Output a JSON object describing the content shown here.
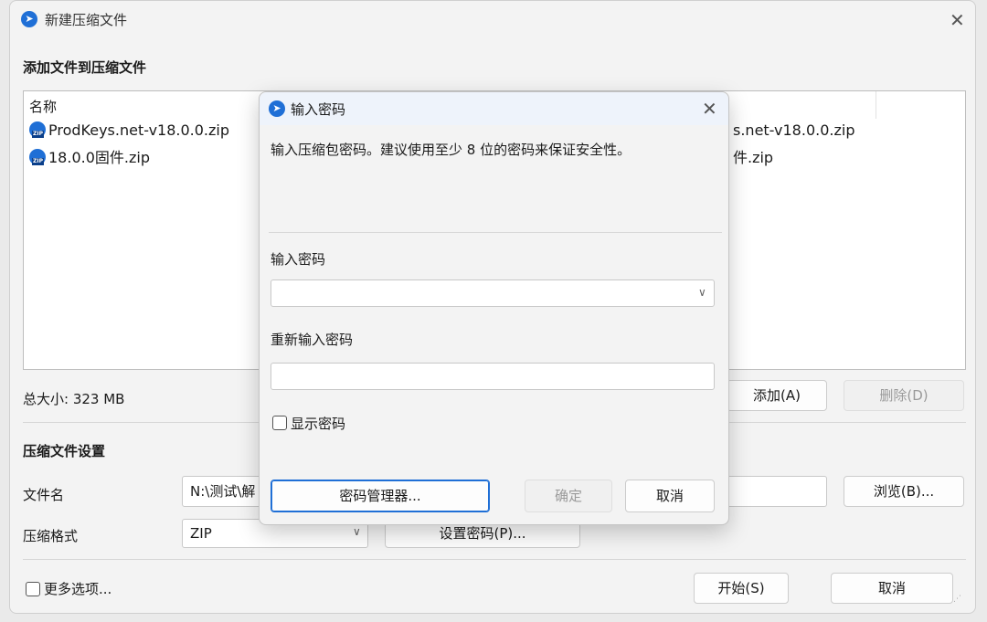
{
  "window": {
    "title": "新建压缩文件",
    "close_symbol": "✕"
  },
  "add_section": {
    "heading": "添加文件到压缩文件",
    "column_name": "名称",
    "files": [
      {
        "name": "ProdKeys.net-v18.0.0.zip"
      },
      {
        "name": "18.0.0固件.zip"
      }
    ],
    "peek_right": [
      "s.net-v18.0.0.zip",
      "件.zip"
    ],
    "total_size": "总大小: 323 MB",
    "add_button": "添加(A)",
    "delete_button": "删除(D)"
  },
  "settings": {
    "heading": "压缩文件设置",
    "filename_label": "文件名",
    "filename_value": "N:\\测试\\解",
    "browse_button": "浏览(B)...",
    "format_label": "压缩格式",
    "format_value": "ZIP",
    "set_password_button": "设置密码(P)..."
  },
  "footer": {
    "more_options": "更多选项...",
    "start_button": "开始(S)",
    "cancel_button": "取消"
  },
  "dialog": {
    "title": "输入密码",
    "close_symbol": "✕",
    "description": "输入压缩包密码。建议使用至少 8 位的密码来保证安全性。",
    "password_label": "输入密码",
    "password_value": "",
    "repeat_label": "重新输入密码",
    "repeat_value": "",
    "show_password": "显示密码",
    "manager_button": "密码管理器...",
    "ok_button": "确定",
    "cancel_button": "取消"
  }
}
